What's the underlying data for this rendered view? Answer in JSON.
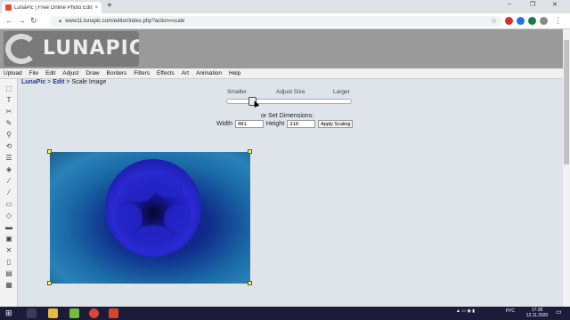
{
  "browser": {
    "tab_title": "LunaPic | Free Online Photo Edit",
    "tab_close": "×",
    "new_tab": "+",
    "url": "www11.lunapic.com/editor/index.php?action=scale",
    "window_controls": [
      "–",
      "❐",
      "✕"
    ]
  },
  "site": {
    "logo_text": "LUNAPIC"
  },
  "menu": [
    "Upload",
    "File",
    "Edit",
    "Adjust",
    "Draw",
    "Borders",
    "Filters",
    "Effects",
    "Art",
    "Animation",
    "Help"
  ],
  "breadcrumb": {
    "home": "LunaPic",
    "sep1": " > ",
    "edit": "Edit",
    "sep2": " > ",
    "current": "Scale Image"
  },
  "scale": {
    "smaller_label": "Smaller",
    "adjust_label": "Adjust Size",
    "larger_label": "Larger",
    "slider_value": 0.2,
    "or_set_label": "or Set Dimensions:",
    "width_label": "Width",
    "width_value": "481",
    "height_label": "Height",
    "height_value": "318",
    "apply_label": "Apply Scaling"
  },
  "taskbar": {
    "time": "17:38",
    "date": "12.11.2020",
    "lang": "РУС"
  }
}
